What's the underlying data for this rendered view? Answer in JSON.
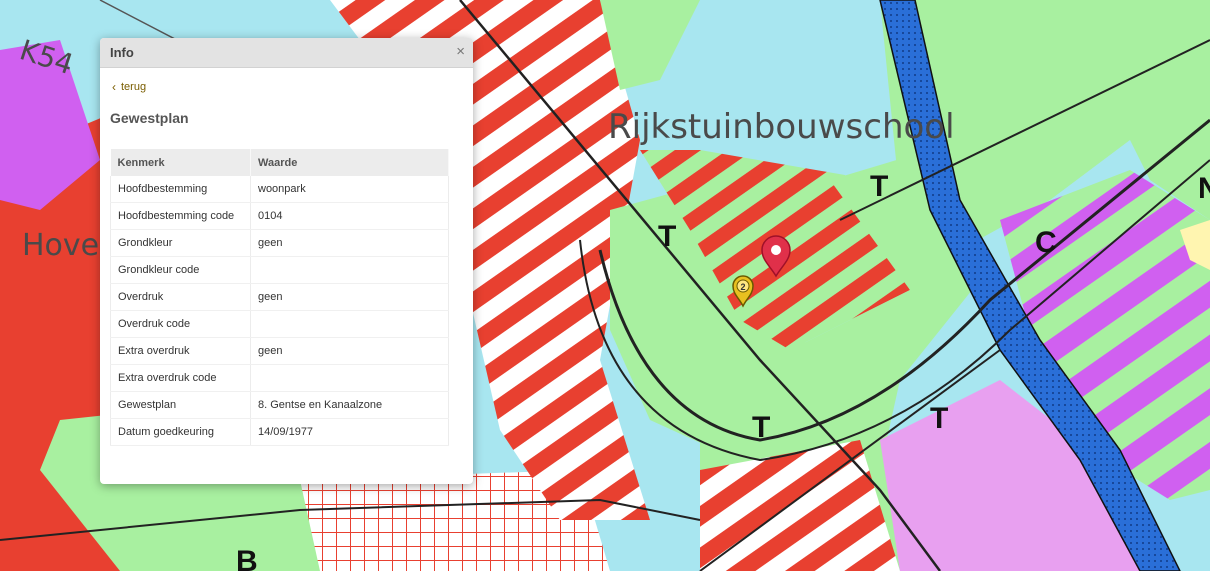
{
  "map": {
    "labels": {
      "school": "Rijkstuinbouwschool",
      "road": "K54",
      "place": "Hove"
    },
    "zone_letters": [
      "T",
      "T",
      "T",
      "T",
      "C",
      "N",
      "B"
    ],
    "marker_badge": "2",
    "colors": {
      "water": "#a8e6f0",
      "residential": "#e84030",
      "green": "#a8f0a0",
      "canal": "#2a6fd8",
      "industry_pink": "#d060f0",
      "light_pink": "#e8a0f0"
    }
  },
  "info": {
    "title": "Info",
    "close_label": "×",
    "back_label": "terug",
    "section_title": "Gewestplan",
    "columns": [
      "Kenmerk",
      "Waarde"
    ],
    "rows": [
      {
        "key": "Hoofdbestemming",
        "value": "woonpark"
      },
      {
        "key": "Hoofdbestemming code",
        "value": "0104"
      },
      {
        "key": "Grondkleur",
        "value": "geen"
      },
      {
        "key": "Grondkleur code",
        "value": ""
      },
      {
        "key": "Overdruk",
        "value": "geen"
      },
      {
        "key": "Overdruk code",
        "value": ""
      },
      {
        "key": "Extra overdruk",
        "value": "geen"
      },
      {
        "key": "Extra overdruk code",
        "value": ""
      },
      {
        "key": "Gewestplan",
        "value": "8. Gentse en Kanaalzone"
      },
      {
        "key": "Datum goedkeuring",
        "value": "14/09/1977"
      }
    ]
  }
}
